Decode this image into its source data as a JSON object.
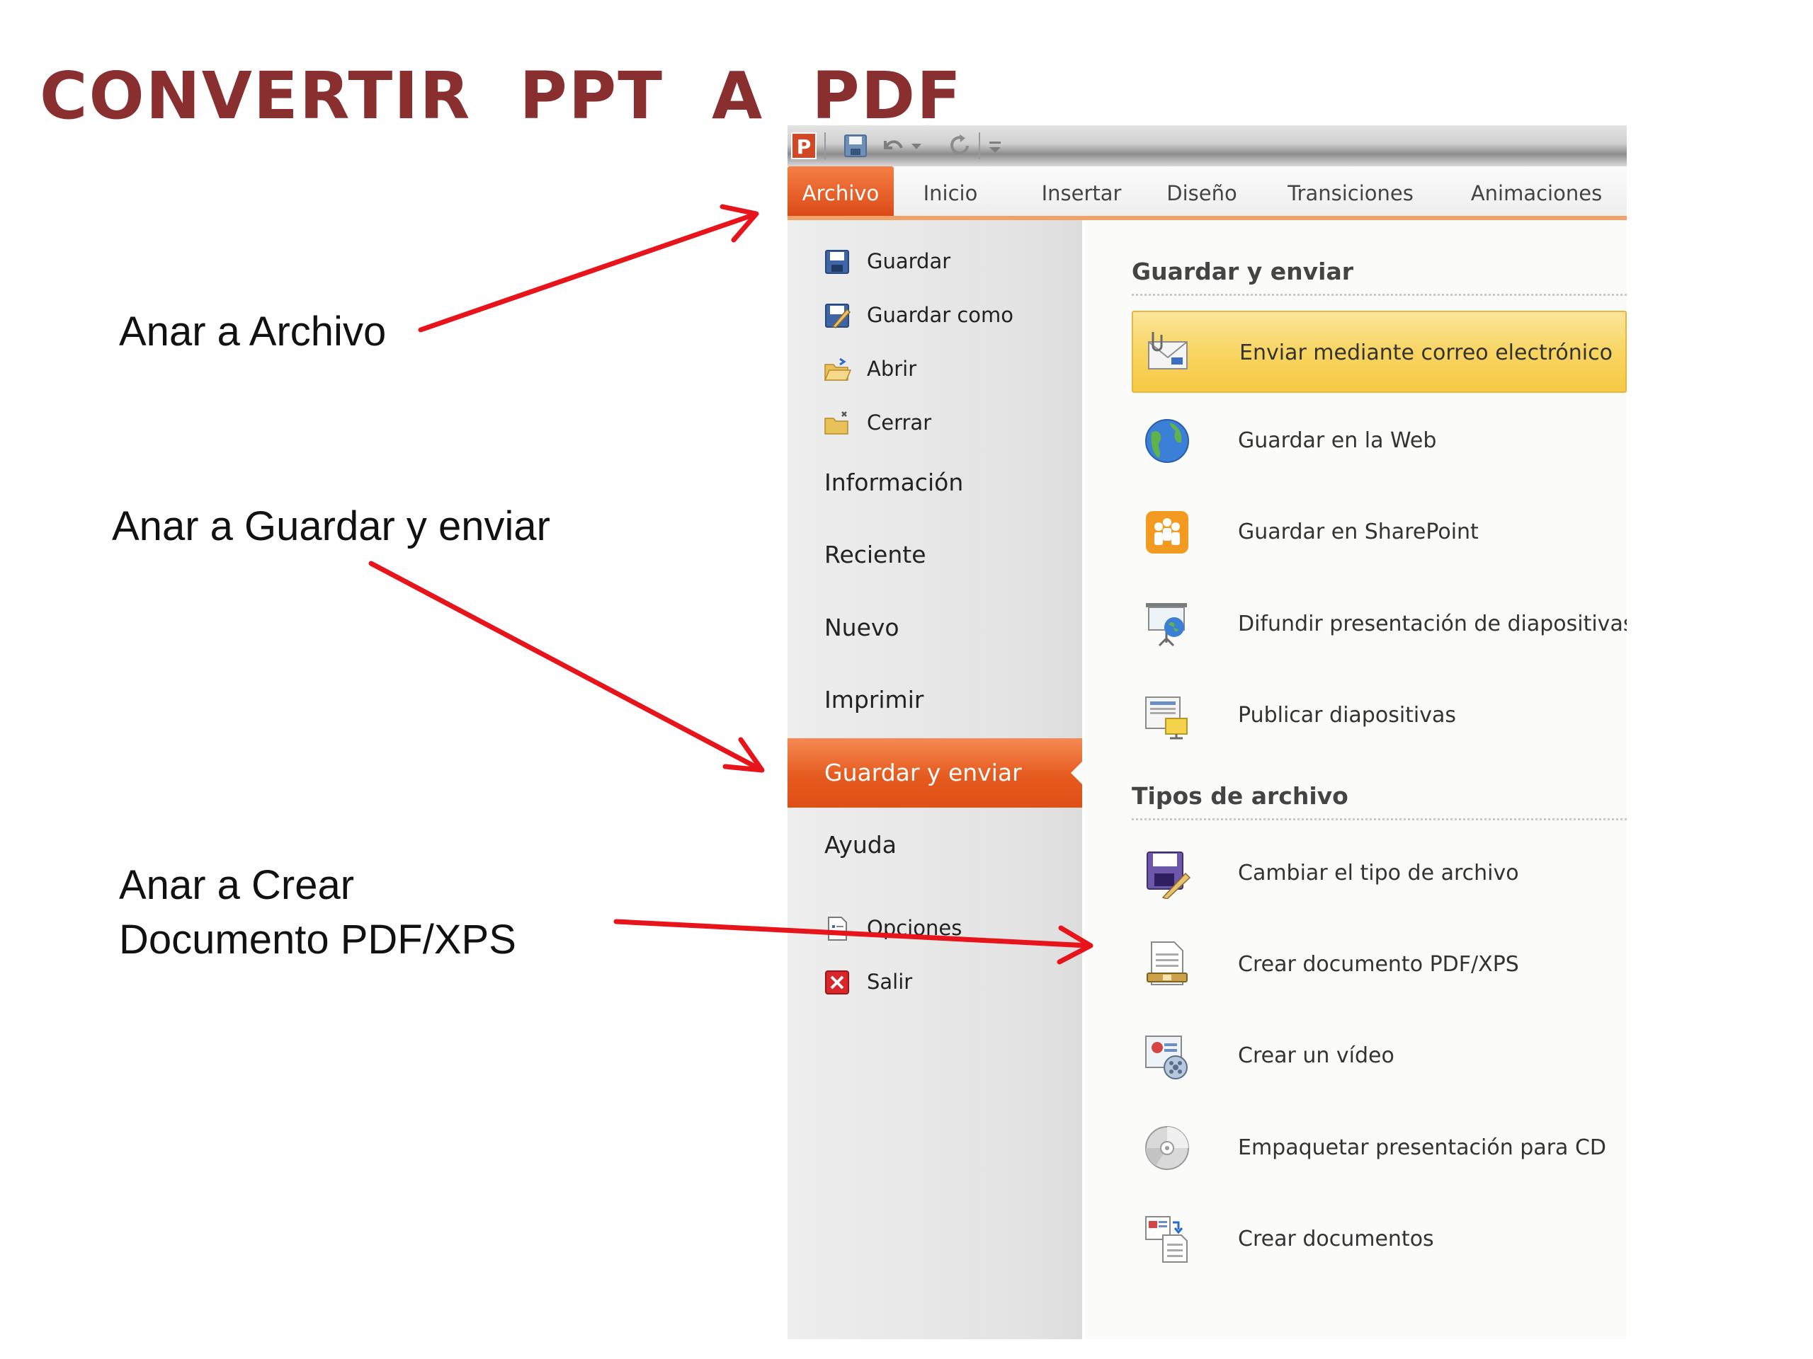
{
  "slide": {
    "title": "CONVERTIR  PPT  A  PDF",
    "annotations": [
      {
        "line1": "Anar a Archivo"
      },
      {
        "line1": "Anar a Guardar y enviar"
      },
      {
        "line1": "Anar a Crear",
        "line2": "Documento PDF/XPS"
      }
    ],
    "arrow_color": "#e8141b"
  },
  "app": {
    "logo_letter": "P",
    "accent_color": "#e35a1f",
    "tabs": [
      "Archivo",
      "Inicio",
      "Insertar",
      "Diseño",
      "Transiciones",
      "Animaciones"
    ],
    "active_tab": "Archivo",
    "backstage_commands_top": [
      "Guardar",
      "Guardar como",
      "Abrir",
      "Cerrar"
    ],
    "backstage_tabs": [
      "Información",
      "Reciente",
      "Nuevo",
      "Imprimir",
      "Guardar y enviar",
      "Ayuda"
    ],
    "active_backstage_tab": "Guardar y enviar",
    "backstage_commands_bottom": [
      "Opciones",
      "Salir"
    ],
    "content": {
      "section1_title": "Guardar y enviar",
      "section1_items": [
        {
          "label": "Enviar mediante correo electrónico",
          "icon": "email-icon",
          "selected": true
        },
        {
          "label": "Guardar en la Web",
          "icon": "globe-icon"
        },
        {
          "label": "Guardar en SharePoint",
          "icon": "sharepoint-icon"
        },
        {
          "label": "Difundir presentación de diapositivas",
          "icon": "broadcast-icon"
        },
        {
          "label": "Publicar diapositivas",
          "icon": "publish-slides-icon"
        }
      ],
      "section2_title": "Tipos de archivo",
      "section2_items": [
        {
          "label": "Cambiar el tipo de archivo",
          "icon": "change-filetype-icon"
        },
        {
          "label": "Crear documento PDF/XPS",
          "icon": "pdf-xps-icon"
        },
        {
          "label": "Crear un vídeo",
          "icon": "video-icon"
        },
        {
          "label": "Empaquetar presentación para CD",
          "icon": "cd-icon"
        },
        {
          "label": "Crear documentos",
          "icon": "handouts-icon"
        }
      ]
    }
  }
}
